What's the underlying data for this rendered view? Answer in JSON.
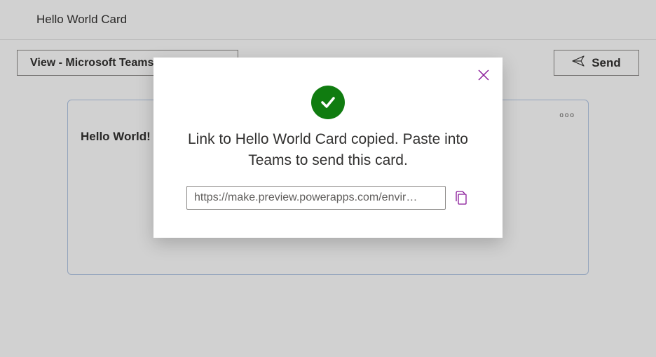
{
  "header": {
    "title": "Hello World Card"
  },
  "toolbar": {
    "view_label": "View - Microsoft Teams -",
    "send_label": "Send"
  },
  "card": {
    "heading": "Hello World!"
  },
  "dialog": {
    "success_alt": "Success",
    "message": "Link to Hello World Card copied. Paste into Teams to send this card.",
    "url_value": "https://make.preview.powerapps.com/envir…"
  }
}
